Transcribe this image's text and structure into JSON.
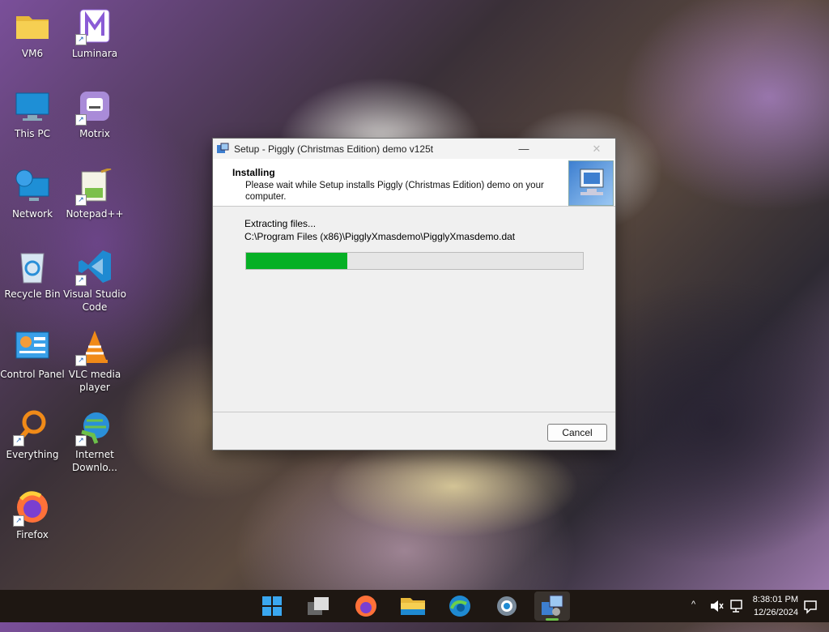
{
  "desktop_icons": [
    {
      "label": "VM6",
      "icon": "folder-icon",
      "shortcut": false
    },
    {
      "label": "Luminara",
      "icon": "luminara-app-icon",
      "shortcut": true
    },
    {
      "label": "This PC",
      "icon": "monitor-icon",
      "shortcut": false
    },
    {
      "label": "Motrix",
      "icon": "motrix-app-icon",
      "shortcut": true
    },
    {
      "label": "Network",
      "icon": "network-icon",
      "shortcut": false
    },
    {
      "label": "Notepad++",
      "icon": "notepadpp-icon",
      "shortcut": true
    },
    {
      "label": "Recycle Bin",
      "icon": "recycle-bin-icon",
      "shortcut": false
    },
    {
      "label": "Visual Studio Code",
      "icon": "vscode-icon",
      "shortcut": true
    },
    {
      "label": "Control Panel",
      "icon": "control-panel-icon",
      "shortcut": false
    },
    {
      "label": "VLC media player",
      "icon": "vlc-icon",
      "shortcut": true
    },
    {
      "label": "Everything",
      "icon": "search-magnifier-icon",
      "shortcut": true
    },
    {
      "label": "Internet Downlo...",
      "icon": "idm-icon",
      "shortcut": true
    },
    {
      "label": "Firefox",
      "icon": "firefox-icon",
      "shortcut": true
    }
  ],
  "installer": {
    "title": "Setup - Piggly (Christmas Edition) demo v125t",
    "header_title": "Installing",
    "header_subtitle": "Please wait while Setup installs Piggly (Christmas Edition) demo on your computer.",
    "status_text": "Extracting files...",
    "file_path": "C:\\Program Files (x86)\\PigglyXmasdemo\\PigglyXmasdemo.dat",
    "progress_fraction": 0.3,
    "cancel_label": "Cancel",
    "progress_color": "#06b025"
  },
  "taskbar": {
    "apps": [
      "start-icon",
      "task-view-icon",
      "firefox-icon",
      "file-explorer-icon",
      "edge-icon",
      "settings-icon",
      "setup-installer-icon"
    ],
    "time": "8:38:01 PM",
    "date": "12/26/2024"
  }
}
